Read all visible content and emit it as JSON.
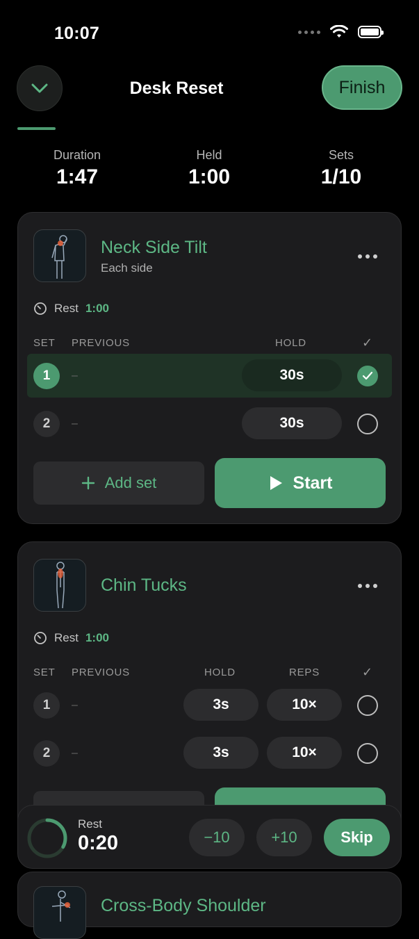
{
  "status_bar": {
    "time": "10:07"
  },
  "header": {
    "title": "Desk Reset",
    "finish_label": "Finish"
  },
  "stats": [
    {
      "label": "Duration",
      "value": "1:47"
    },
    {
      "label": "Held",
      "value": "1:00"
    },
    {
      "label": "Sets",
      "value": "1/10"
    }
  ],
  "exercises": [
    {
      "name": "Neck Side Tilt",
      "subtitle": "Each side",
      "rest_label": "Rest",
      "rest_value": "1:00",
      "columns": {
        "set": "SET",
        "previous": "PREVIOUS",
        "hold": "HOLD",
        "check": "✓"
      },
      "sets": [
        {
          "number": "1",
          "previous": "–",
          "hold": "30s",
          "completed": true
        },
        {
          "number": "2",
          "previous": "–",
          "hold": "30s",
          "completed": false
        }
      ],
      "add_set_label": "Add set",
      "start_label": "Start"
    },
    {
      "name": "Chin Tucks",
      "rest_label": "Rest",
      "rest_value": "1:00",
      "columns": {
        "set": "SET",
        "previous": "PREVIOUS",
        "hold": "HOLD",
        "reps": "REPS",
        "check": "✓"
      },
      "sets": [
        {
          "number": "1",
          "previous": "–",
          "hold": "3s",
          "reps": "10×",
          "completed": false
        },
        {
          "number": "2",
          "previous": "–",
          "hold": "3s",
          "reps": "10×",
          "completed": false
        }
      ]
    },
    {
      "name": "Cross-Body Shoulder"
    }
  ],
  "rest_timer": {
    "label": "Rest",
    "value": "0:20",
    "progress": 0.33,
    "minus_label": "−10",
    "plus_label": "+10",
    "skip_label": "Skip"
  },
  "colors": {
    "accent": "#4c9a70",
    "accent_text": "#5db785",
    "background": "#000000",
    "card": "#1c1c1e"
  }
}
